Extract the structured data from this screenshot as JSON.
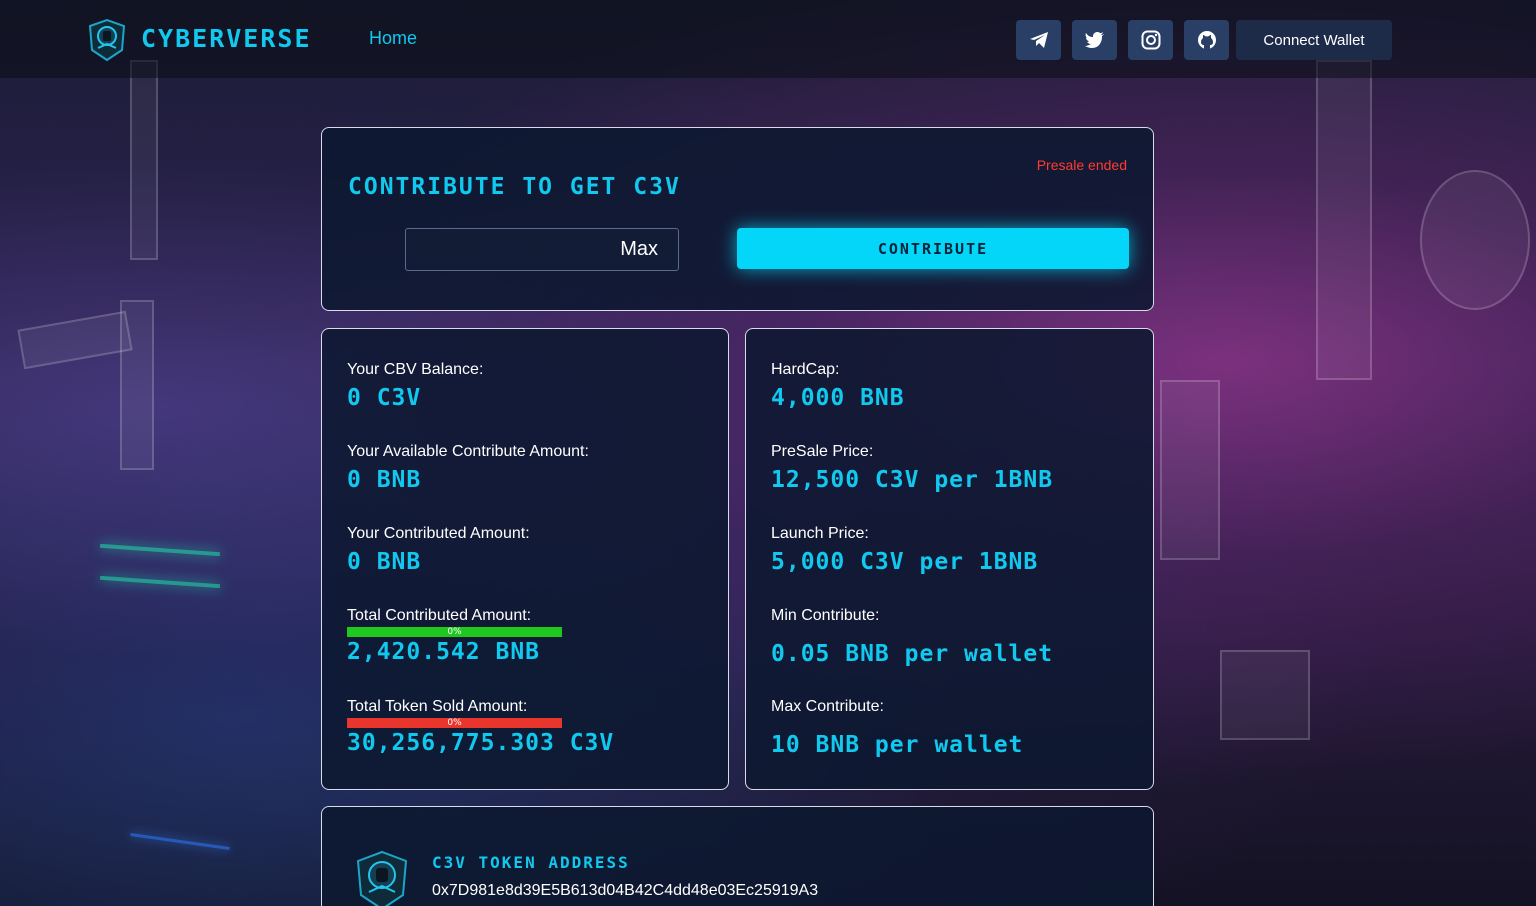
{
  "header": {
    "brand": "CYBERVERSE",
    "nav_home": "Home",
    "social": [
      "telegram-icon",
      "twitter-icon",
      "instagram-icon",
      "github-icon"
    ],
    "connect_wallet": "Connect Wallet"
  },
  "contribute": {
    "title": "Contribute to get C3V",
    "status": "Presale ended",
    "amount_value": "",
    "max_label": "Max",
    "button_label": "contribute"
  },
  "user_stats": {
    "balance_label": "Your CBV Balance:",
    "balance_value": "0 C3V",
    "available_label": "Your Available Contribute Amount:",
    "available_value": "0 BNB",
    "contributed_label": "Your Contributed Amount:",
    "contributed_value": "0 BNB",
    "total_contributed_label": "Total Contributed Amount:",
    "total_contributed_progress": "0%",
    "total_contributed_progress_value": 0,
    "total_contributed_value": "2,420.542 BNB",
    "total_sold_label": "Total Token Sold Amount:",
    "total_sold_progress": "0%",
    "total_sold_progress_value": 0,
    "total_sold_value": "30,256,775.303 C3V"
  },
  "sale_info": {
    "hardcap_label": "HardCap:",
    "hardcap_value": "4,000 BNB",
    "presale_price_label": "PreSale Price:",
    "presale_price_value": "12,500 C3V per 1BNB",
    "launch_price_label": "Launch Price:",
    "launch_price_value": "5,000 C3V per 1BNB",
    "min_contribute_label": "Min Contribute:",
    "min_contribute_value": "0.05 BNB per wallet",
    "max_contribute_label": "Max Contribute:",
    "max_contribute_value": "10 BNB per wallet"
  },
  "token": {
    "title": "C3V Token Address",
    "address": "0x7D981e8d39E5B613d04B42C4dd48e03Ec25919A3"
  },
  "colors": {
    "accent": "#11c8ef",
    "button": "#03d6f8",
    "status_error": "#ff3b30",
    "progress_green": "#1fc81f",
    "progress_red": "#e8362c",
    "social_bg": "#2a3f66"
  }
}
